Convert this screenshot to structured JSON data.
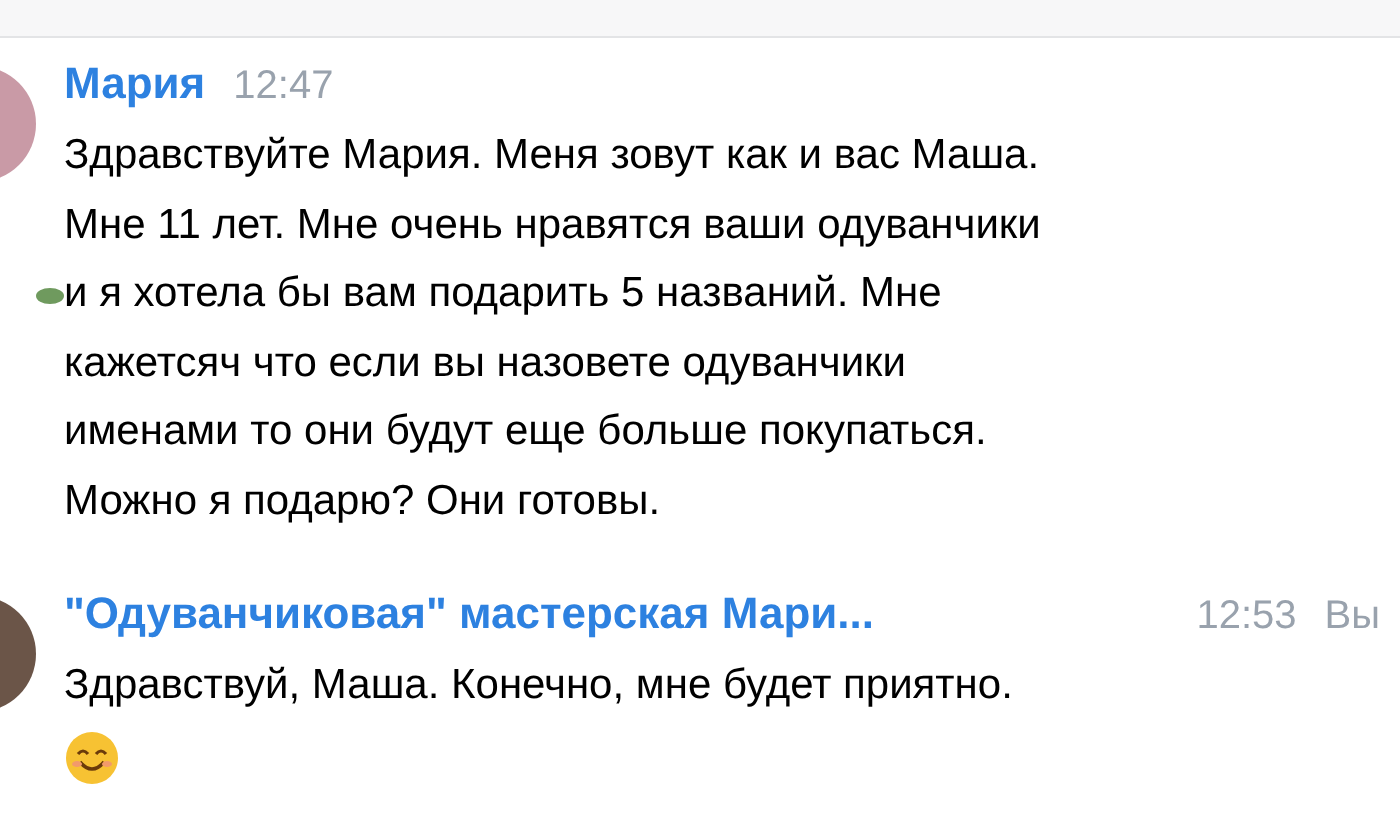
{
  "messages": [
    {
      "author": "Мария",
      "time": "12:47",
      "text": "Здравствуйте Мария. Меня зовут как и вас Маша.\nМне 11 лет. Мне очень нравятся ваши одуванчики\nи я хотела бы вам подарить 5 названий. Мне\nкажетсяч что если вы назовете одуванчики\nименами то они будут еще больше покупаться.\nМожно я подарю? Они готовы.",
      "marked": true
    },
    {
      "author": "\"Одуванчиковая\" мастерская Мари...",
      "time": "12:53",
      "status": "Вы",
      "text": "Здравствуй, Маша. Конечно, мне будет приятно.",
      "emoji": true,
      "marked": false
    }
  ]
}
